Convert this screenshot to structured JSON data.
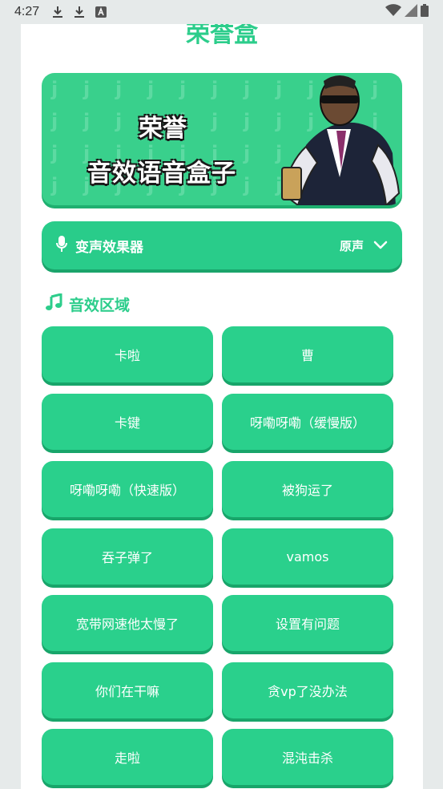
{
  "status_bar": {
    "time": "4:27",
    "icons": [
      "download-icon",
      "download-icon",
      "font-icon"
    ],
    "right_icons": [
      "wifi-icon",
      "signal-icon",
      "battery-icon"
    ]
  },
  "app": {
    "title": "荣誉盒"
  },
  "banner": {
    "line1": "荣誉",
    "line2": "音效语音盒子"
  },
  "voice_changer": {
    "label": "变声效果器",
    "value": "原声",
    "icon": "microphone-icon"
  },
  "sfx_section": {
    "title": "音效区域",
    "icon": "music-note-icon",
    "buttons": [
      "卡啦",
      "曹",
      "卡键",
      "呀嘞呀嘞（缓慢版）",
      "呀嘞呀嘞（快速版）",
      "被狗运了",
      "吞子弹了",
      "vamos",
      "宽带网速他太慢了",
      "设置有问题",
      "你们在干嘛",
      "贪vp了没办法",
      "走啦",
      "混沌击杀"
    ]
  },
  "colors": {
    "accent": "#2ccd8b",
    "button": "#2ad08c",
    "button_shadow": "#18a56a"
  }
}
